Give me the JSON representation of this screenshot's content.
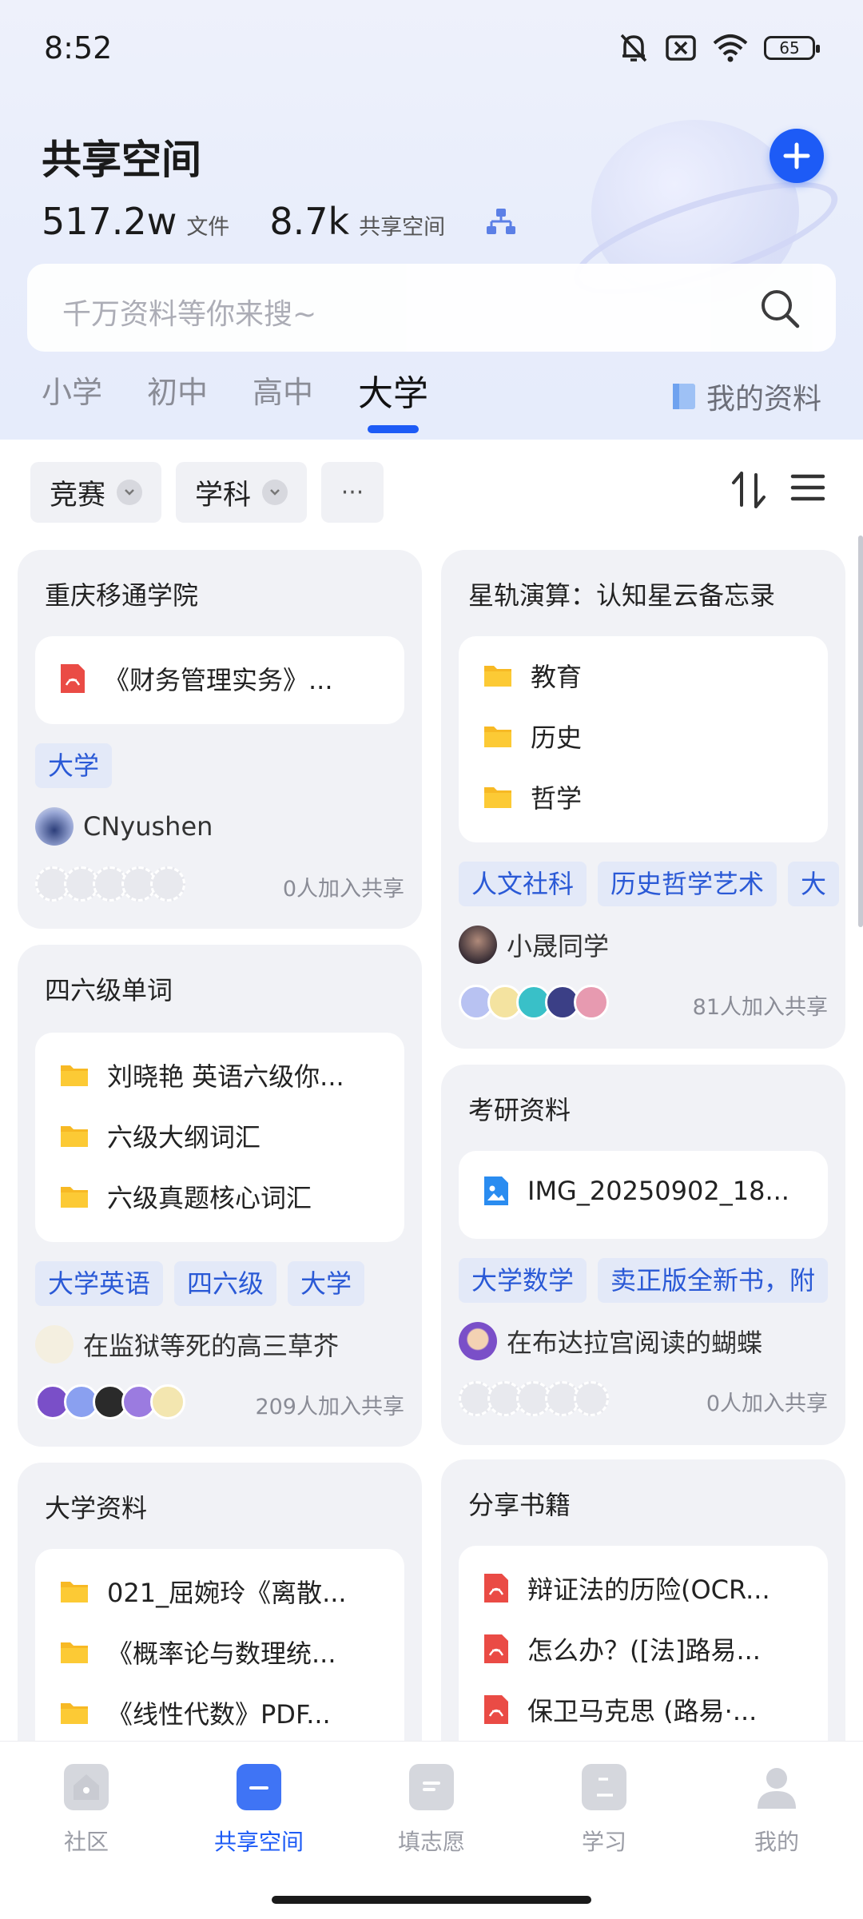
{
  "status_bar": {
    "time": "8:52",
    "battery": "65"
  },
  "header": {
    "title": "共享空间",
    "stats": [
      {
        "value": "517.2w",
        "unit": "文件"
      },
      {
        "value": "8.7k",
        "unit": "共享空间"
      }
    ]
  },
  "search": {
    "placeholder": "千万资料等你来搜~"
  },
  "tabs": [
    {
      "label": "小学"
    },
    {
      "label": "初中"
    },
    {
      "label": "高中"
    },
    {
      "label": "大学",
      "active": true
    }
  ],
  "my_resources": "我的资料",
  "filters": {
    "competition": "竞赛",
    "subject": "学科",
    "more": "···"
  },
  "colors": {
    "accent": "#1d5bf6",
    "tag_bg": "#e3e9f8",
    "tag_text": "#2a59d6",
    "card_bg": "#f1f2f6"
  },
  "cards": [
    {
      "title": "重庆移通学院",
      "files": [
        {
          "icon": "pdf-icon",
          "name": "《财务管理实务》..."
        }
      ],
      "tags": [
        "大学"
      ],
      "owner": "CNyushen",
      "joined": "0人加入共享"
    },
    {
      "title": "星轨演算：认知星云备忘录",
      "files": [
        {
          "icon": "folder-icon",
          "name": "教育"
        },
        {
          "icon": "folder-icon",
          "name": "历史"
        },
        {
          "icon": "folder-icon",
          "name": "哲学"
        }
      ],
      "tags": [
        "人文社科",
        "历史哲学艺术",
        "大"
      ],
      "owner": "小晟同学",
      "joined": "81人加入共享"
    },
    {
      "title": "四六级单词",
      "files": [
        {
          "icon": "folder-icon",
          "name": "刘晓艳 英语六级你..."
        },
        {
          "icon": "folder-icon",
          "name": "六级大纲词汇"
        },
        {
          "icon": "folder-icon",
          "name": "六级真题核心词汇"
        }
      ],
      "tags": [
        "大学英语",
        "四六级",
        "大学"
      ],
      "owner": "在监狱等死的高三草芥",
      "joined": "209人加入共享"
    },
    {
      "title": "考研资料",
      "files": [
        {
          "icon": "image-file-icon",
          "name": "IMG_20250902_18..."
        }
      ],
      "tags": [
        "大学数学",
        "卖正版全新书，附"
      ],
      "owner": "在布达拉宫阅读的蝴蝶",
      "joined": "0人加入共享"
    },
    {
      "title": "大学资料",
      "files": [
        {
          "icon": "folder-icon",
          "name": "021_屈婉玲《离散..."
        },
        {
          "icon": "folder-icon",
          "name": "《概率论与数理统..."
        },
        {
          "icon": "folder-icon",
          "name": "《线性代数》PDF..."
        }
      ]
    },
    {
      "title": "分享书籍",
      "files": [
        {
          "icon": "pdf-icon",
          "name": "辩证法的历险(OCR..."
        },
        {
          "icon": "pdf-icon",
          "name": "怎么办？([法]路易..."
        },
        {
          "icon": "pdf-icon",
          "name": "保卫马克思 (路易·..."
        }
      ]
    }
  ],
  "bottom_nav": [
    {
      "label": "社区"
    },
    {
      "label": "共享空间",
      "active": true
    },
    {
      "label": "填志愿"
    },
    {
      "label": "学习"
    },
    {
      "label": "我的"
    }
  ]
}
